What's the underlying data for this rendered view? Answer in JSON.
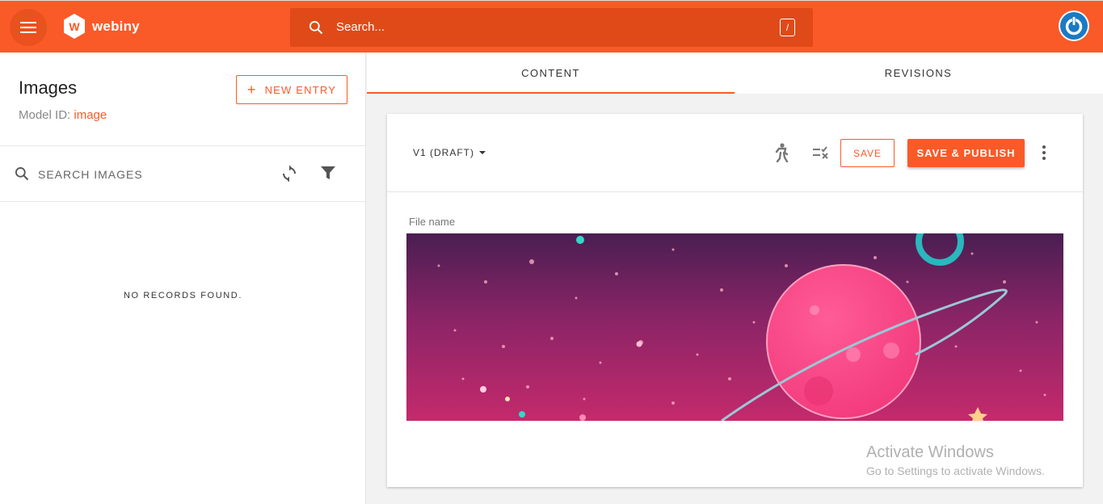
{
  "app": {
    "brand": "webiny",
    "search_placeholder": "Search...",
    "search_shortcut": "/"
  },
  "sidebar": {
    "title": "Images",
    "model_id_label": "Model ID:",
    "model_id_value": "image",
    "new_entry_label": "NEW ENTRY",
    "search_placeholder": "SEARCH IMAGES",
    "empty_text": "NO RECORDS FOUND."
  },
  "tabs": [
    {
      "label": "CONTENT",
      "active": true
    },
    {
      "label": "REVISIONS",
      "active": false
    }
  ],
  "editor": {
    "version_label": "V1 (DRAFT)",
    "save_label": "SAVE",
    "publish_label": "SAVE & PUBLISH",
    "field_label": "File name"
  },
  "watermark": {
    "line1": "Activate Windows",
    "line2": "Go to Settings to activate Windows."
  },
  "colors": {
    "brand": "#fa5a28",
    "search_bg": "#e04a18"
  }
}
